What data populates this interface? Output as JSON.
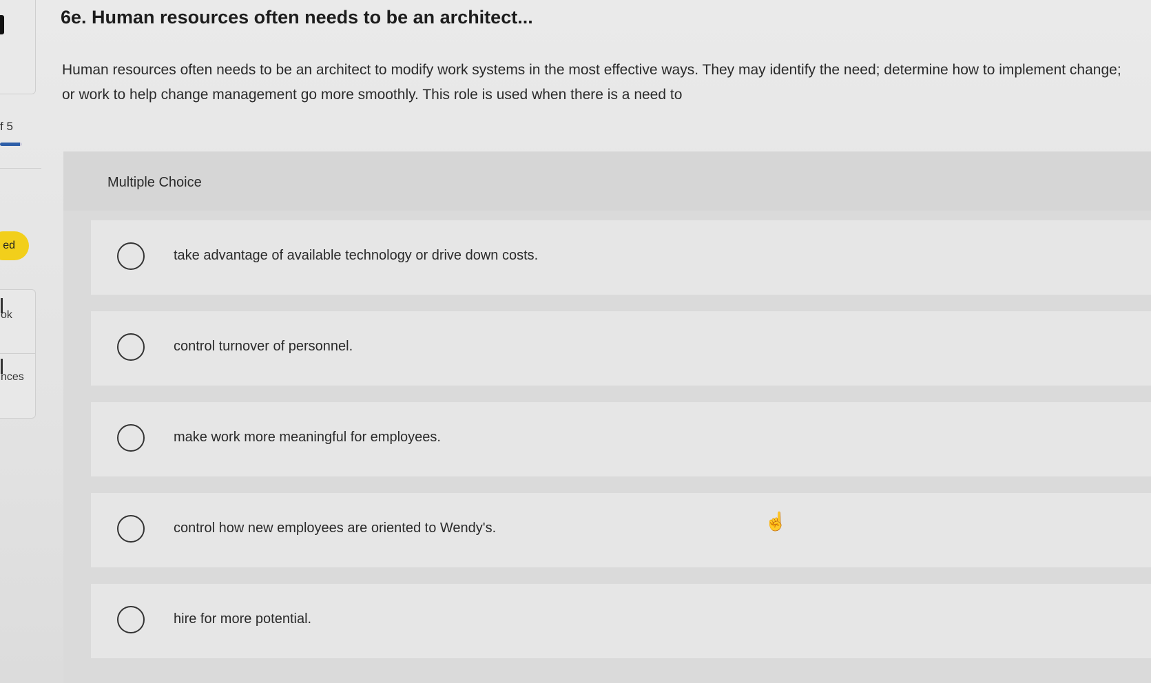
{
  "sidebar": {
    "progress_text": "f 5",
    "progress_fraction": 0.9,
    "status_badge": "ed",
    "tools": [
      {
        "label": "ok",
        "icon": "ebook-icon"
      },
      {
        "label": "nces",
        "icon": "references-icon"
      }
    ]
  },
  "question": {
    "title": "6e. Human resources often needs to be an architect...",
    "body": "Human resources often needs to be an architect to modify work systems in the most effective ways. They may identify the need; determine how to implement change; or work to help change management go more smoothly. This role is used when there is a need to"
  },
  "multiple_choice": {
    "label": "Multiple Choice",
    "options": [
      {
        "text": "take advantage of available technology or drive down costs.",
        "selected": false
      },
      {
        "text": "control turnover of personnel.",
        "selected": false
      },
      {
        "text": "make work more meaningful for employees.",
        "selected": false
      },
      {
        "text": "control how new employees are oriented to Wendy's.",
        "selected": false
      },
      {
        "text": "hire for more potential.",
        "selected": false
      }
    ]
  },
  "cursor": {
    "icon": "hand-pointer-icon",
    "glyph": "☝"
  },
  "colors": {
    "badge": "#f2cf1b",
    "progress": "#2d5ea8"
  }
}
